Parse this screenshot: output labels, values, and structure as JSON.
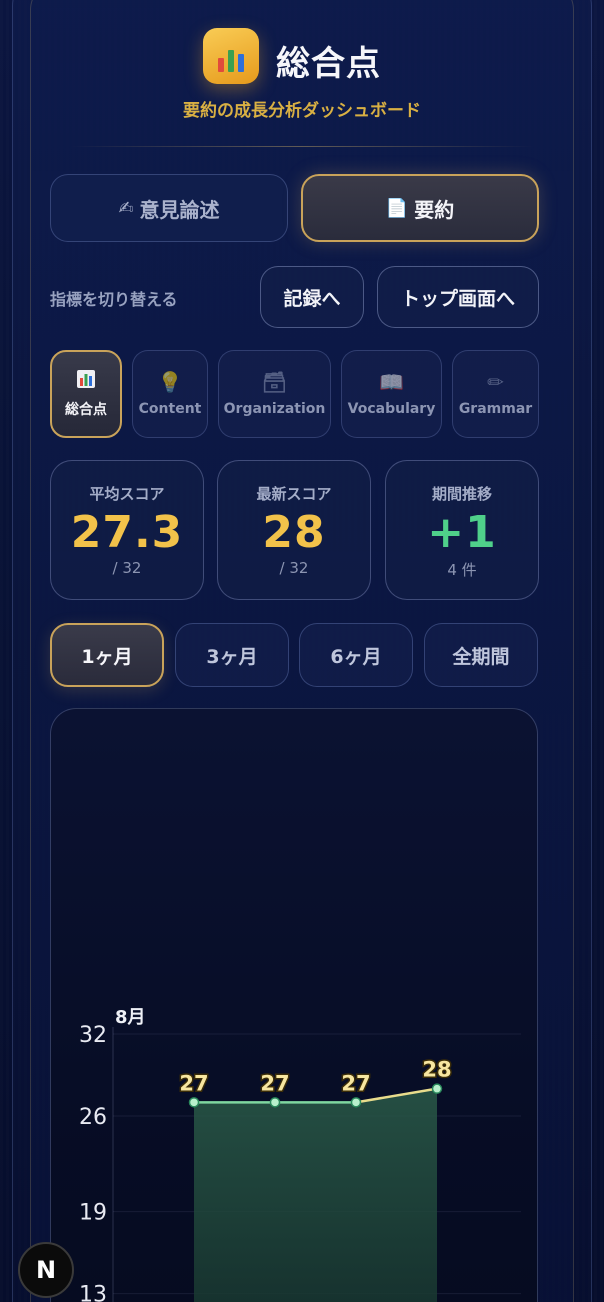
{
  "header": {
    "logo_icon": "bar-chart-icon",
    "title": "総合点",
    "subtitle": "要約の成長分析ダッシュボード"
  },
  "mode_tabs": [
    {
      "icon": "✍",
      "icon_name": "writing-hand-icon",
      "label": "意見論述",
      "active": false
    },
    {
      "icon": "📄",
      "icon_name": "document-icon",
      "label": "要約",
      "active": true
    }
  ],
  "switch_label": "指標を切り替える",
  "nav_buttons": {
    "records": "記録へ",
    "top": "トップ画面へ"
  },
  "metric_tabs": [
    {
      "icon_name": "bar-chart-icon",
      "label": "総合点",
      "active": true
    },
    {
      "icon": "💡",
      "icon_name": "lightbulb-icon",
      "label": "Content",
      "active": false
    },
    {
      "icon": "🗃",
      "icon_name": "file-box-icon",
      "label": "Organization",
      "active": false
    },
    {
      "icon": "📖",
      "icon_name": "book-icon",
      "label": "Vocabulary",
      "active": false
    },
    {
      "icon": "✏",
      "icon_name": "pencil-icon",
      "label": "Grammar",
      "active": false
    }
  ],
  "stats": {
    "average": {
      "label": "平均スコア",
      "value": "27.3",
      "sub": "/ 32"
    },
    "latest": {
      "label": "最新スコア",
      "value": "28",
      "sub": "/ 32"
    },
    "trend": {
      "label": "期間推移",
      "value": "+1",
      "sub": "4 件"
    }
  },
  "periods": [
    {
      "label": "1ヶ月",
      "active": true
    },
    {
      "label": "3ヶ月",
      "active": false
    },
    {
      "label": "6ヶ月",
      "active": false
    },
    {
      "label": "全期間",
      "active": false
    }
  ],
  "colors": {
    "gold": "#f2c24a",
    "green": "#4fd08a",
    "accent_border": "#c9a35a",
    "line_green": "#7fd6a0",
    "line_yellow": "#e8dc8c"
  },
  "chart_data": {
    "type": "area",
    "month_label": "8月",
    "y_ticks": [
      32,
      26,
      19,
      13
    ],
    "ylim": [
      13,
      32
    ],
    "points": [
      {
        "label": "27",
        "y": 27
      },
      {
        "label": "27",
        "y": 27
      },
      {
        "label": "27",
        "y": 27
      },
      {
        "label": "28",
        "y": 28
      }
    ],
    "grid": true
  },
  "badge": {
    "letter": "N"
  }
}
